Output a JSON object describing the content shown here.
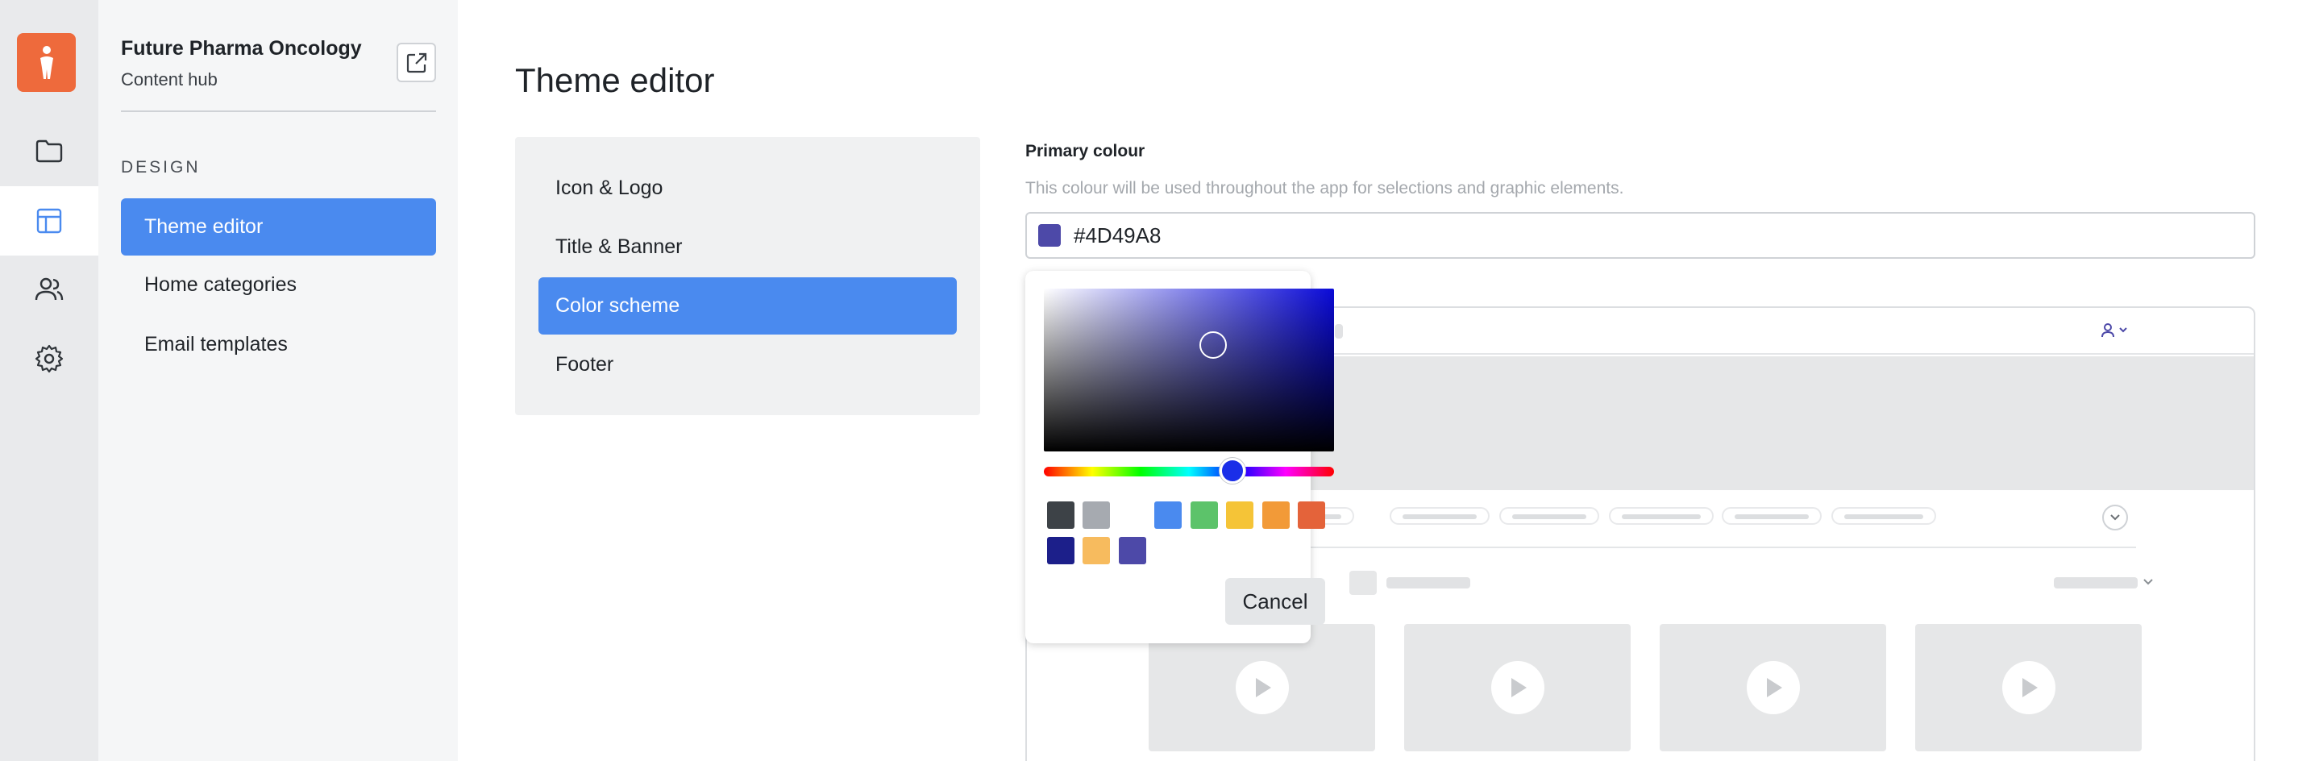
{
  "rail": {
    "items": [
      {
        "icon": "folder-icon"
      },
      {
        "icon": "layout-icon"
      },
      {
        "icon": "users-icon"
      },
      {
        "icon": "gear-icon"
      }
    ],
    "active_index": 1,
    "logo_icon": "person-logo-icon",
    "logo_color": "#ee6a3c"
  },
  "sidebar": {
    "org_name": "Future Pharma Oncology",
    "org_subtitle": "Content hub",
    "open_external_icon": "external-link-icon",
    "section_label": "DESIGN",
    "items": [
      {
        "label": "Theme editor",
        "active": true
      },
      {
        "label": "Home categories",
        "active": false
      },
      {
        "label": "Email templates",
        "active": false
      }
    ]
  },
  "main": {
    "title": "Theme editor",
    "tabs": [
      {
        "label": "Icon & Logo"
      },
      {
        "label": "Title & Banner"
      },
      {
        "label": "Color scheme",
        "active": true
      },
      {
        "label": "Footer"
      }
    ],
    "primary_colour": {
      "label": "Primary colour",
      "help": "This colour will be used throughout the app for selections and graphic elements.",
      "value": "#4D49A8"
    }
  },
  "color_picker": {
    "hue_color": "#0a0ad8",
    "presets": [
      "#3d4247",
      "#a6aab0",
      "#ffffff",
      "#4a8aef",
      "#5cc36a",
      "#f5c437",
      "#f29a38",
      "#e4633a",
      "#1c1f8a",
      "#f7bb5e",
      "#4d49a8"
    ],
    "cancel_label": "Cancel"
  },
  "colors": {
    "accent": "#4a8aef",
    "rail_bg": "#e9eaec",
    "sidebar_bg": "#f5f6f7"
  }
}
